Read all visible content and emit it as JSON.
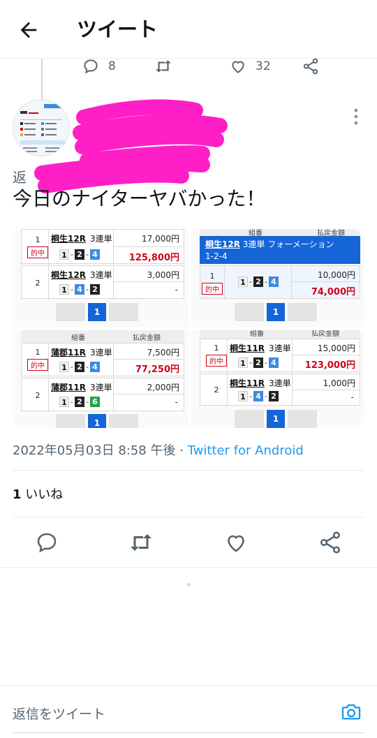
{
  "header": {
    "title": "ツイート"
  },
  "previous_tweet": {
    "reply_count": "8",
    "like_count": "32"
  },
  "tweet": {
    "reply_prefix": "返",
    "text": "今日のナイターヤバかった！",
    "timestamp": "2022年05月03日 8:58 午後",
    "separator": " · ",
    "client": "Twitter for Android",
    "like_count": "1",
    "like_label": "いいね"
  },
  "media": {
    "hit_label": "的中",
    "page_label": "1",
    "combo_sep": "-",
    "bet_type": "3連単",
    "panel1": {
      "rows": [
        {
          "num": "1",
          "race": "桐生12R",
          "stake": "17,000円",
          "payout": "125,800円",
          "combo": [
            "1",
            "2",
            "4"
          ]
        },
        {
          "num": "2",
          "race": "桐生12R",
          "stake": "3,000円",
          "payout": "-",
          "combo": [
            "1",
            "4",
            "2"
          ]
        }
      ]
    },
    "panel2": {
      "header_left": "組番",
      "header_right": "払戻金額",
      "race": "桐生12R",
      "formation": "3連単 フォーメーション",
      "formation_combo": "1-2-4",
      "num": "1",
      "stake": "10,000円",
      "payout": "74,000円",
      "combo": [
        "1",
        "2",
        "4"
      ]
    },
    "panel3": {
      "header_left": "組番",
      "header_right": "払戻金額",
      "rows": [
        {
          "num": "1",
          "race": "蒲郡11R",
          "stake": "7,500円",
          "payout": "77,250円",
          "combo": [
            "1",
            "2",
            "4"
          ]
        },
        {
          "num": "2",
          "race": "蒲郡11R",
          "stake": "2,000円",
          "payout": "-",
          "combo": [
            "1",
            "2",
            "6"
          ]
        }
      ]
    },
    "panel4": {
      "header_left": "組番",
      "header_right": "払戻金額",
      "rows": [
        {
          "num": "1",
          "race": "桐生11R",
          "stake": "15,000円",
          "payout": "123,000円",
          "combo": [
            "1",
            "2",
            "4"
          ]
        },
        {
          "num": "2",
          "race": "桐生11R",
          "stake": "1,000円",
          "payout": "-",
          "combo": [
            "1",
            "4",
            "2"
          ]
        }
      ]
    }
  },
  "compose": {
    "placeholder": "返信をツイート"
  },
  "colors": {
    "accent": "#1d9bf0",
    "scribble": "#ff1fc6",
    "hit_red": "#d0021b",
    "pager_blue": "#1565d8"
  },
  "icons": [
    "back-arrow-icon",
    "reply-icon",
    "retweet-icon",
    "like-icon",
    "share-icon",
    "more-icon",
    "camera-icon"
  ]
}
